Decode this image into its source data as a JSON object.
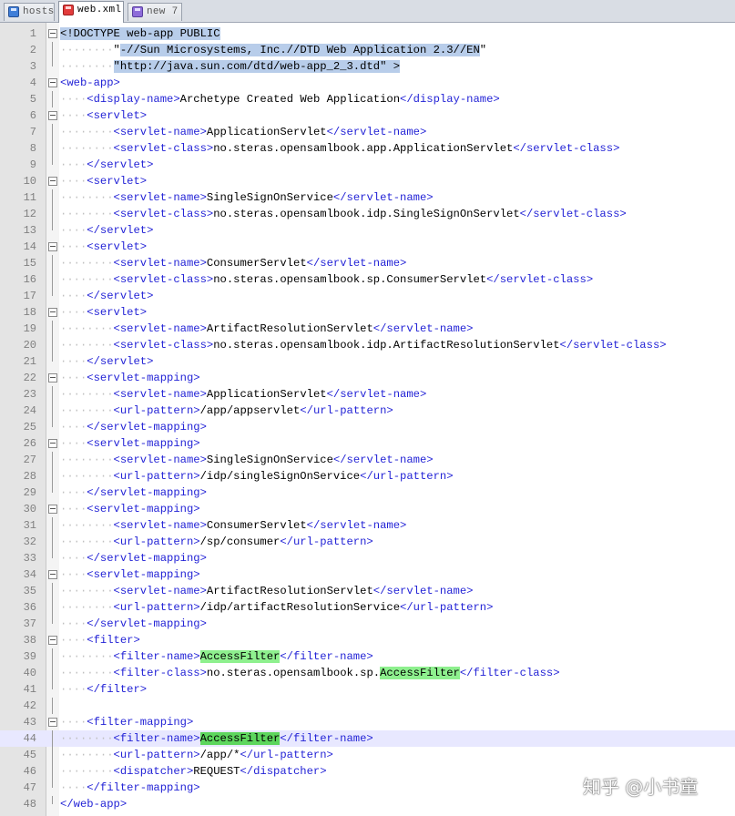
{
  "tabs": [
    {
      "label": "hosts",
      "icon": "save-icon",
      "active": false
    },
    {
      "label": "web.xml",
      "icon": "modified-save-icon",
      "active": true
    },
    {
      "label": "new  7",
      "icon": "new-file-icon",
      "active": false
    }
  ],
  "editor": {
    "current_line": 44,
    "lines": [
      {
        "n": "1",
        "fold": "open",
        "segs": [
          [
            "sel",
            "<"
          ],
          [
            "sel",
            "!DOCTYPE web-app PUBLIC"
          ]
        ]
      },
      {
        "n": "2",
        "fold": "line",
        "segs": [
          [
            "ws",
            "········"
          ],
          [
            "",
            "\""
          ],
          [
            "sel",
            "-//Sun Microsystems, Inc.//DTD Web Application 2.3//EN"
          ],
          [
            "",
            "\""
          ]
        ]
      },
      {
        "n": "3",
        "fold": "end",
        "segs": [
          [
            "ws",
            "········"
          ],
          [
            "sel",
            "\"http://java.sun.com/dtd/web-app_2_3.dtd\" >"
          ]
        ]
      },
      {
        "n": "4",
        "fold": "open",
        "segs": [
          [
            "t",
            "<web-app>"
          ]
        ]
      },
      {
        "n": "5",
        "fold": "line",
        "segs": [
          [
            "ws",
            "····"
          ],
          [
            "t",
            "<display-name>"
          ],
          [
            "",
            "Archetype Created Web Application"
          ],
          [
            "t",
            "</display-name>"
          ]
        ]
      },
      {
        "n": "6",
        "fold": "open",
        "segs": [
          [
            "ws",
            "····"
          ],
          [
            "t",
            "<servlet>"
          ]
        ]
      },
      {
        "n": "7",
        "fold": "line",
        "segs": [
          [
            "ws",
            "········"
          ],
          [
            "t",
            "<servlet-name>"
          ],
          [
            "",
            "ApplicationServlet"
          ],
          [
            "t",
            "</servlet-name>"
          ]
        ]
      },
      {
        "n": "8",
        "fold": "line",
        "segs": [
          [
            "ws",
            "········"
          ],
          [
            "t",
            "<servlet-class>"
          ],
          [
            "",
            "no.steras.opensamlbook.app.ApplicationServlet"
          ],
          [
            "t",
            "</servlet-class>"
          ]
        ]
      },
      {
        "n": "9",
        "fold": "end",
        "segs": [
          [
            "ws",
            "····"
          ],
          [
            "t",
            "</servlet>"
          ]
        ]
      },
      {
        "n": "10",
        "fold": "open",
        "segs": [
          [
            "ws",
            "····"
          ],
          [
            "t",
            "<servlet>"
          ]
        ]
      },
      {
        "n": "11",
        "fold": "line",
        "segs": [
          [
            "ws",
            "········"
          ],
          [
            "t",
            "<servlet-name>"
          ],
          [
            "",
            "SingleSignOnService"
          ],
          [
            "t",
            "</servlet-name>"
          ]
        ]
      },
      {
        "n": "12",
        "fold": "line",
        "segs": [
          [
            "ws",
            "········"
          ],
          [
            "t",
            "<servlet-class>"
          ],
          [
            "",
            "no.steras.opensamlbook.idp.SingleSignOnServlet"
          ],
          [
            "t",
            "</servlet-class>"
          ]
        ]
      },
      {
        "n": "13",
        "fold": "end",
        "segs": [
          [
            "ws",
            "····"
          ],
          [
            "t",
            "</servlet>"
          ]
        ]
      },
      {
        "n": "14",
        "fold": "open",
        "segs": [
          [
            "ws",
            "····"
          ],
          [
            "t",
            "<servlet>"
          ]
        ]
      },
      {
        "n": "15",
        "fold": "line",
        "segs": [
          [
            "ws",
            "········"
          ],
          [
            "t",
            "<servlet-name>"
          ],
          [
            "",
            "ConsumerServlet"
          ],
          [
            "t",
            "</servlet-name>"
          ]
        ]
      },
      {
        "n": "16",
        "fold": "line",
        "segs": [
          [
            "ws",
            "········"
          ],
          [
            "t",
            "<servlet-class>"
          ],
          [
            "",
            "no.steras.opensamlbook.sp.ConsumerServlet"
          ],
          [
            "t",
            "</servlet-class>"
          ]
        ]
      },
      {
        "n": "17",
        "fold": "end",
        "segs": [
          [
            "ws",
            "····"
          ],
          [
            "t",
            "</servlet>"
          ]
        ]
      },
      {
        "n": "18",
        "fold": "open",
        "segs": [
          [
            "ws",
            "····"
          ],
          [
            "t",
            "<servlet>"
          ]
        ]
      },
      {
        "n": "19",
        "fold": "line",
        "segs": [
          [
            "ws",
            "········"
          ],
          [
            "t",
            "<servlet-name>"
          ],
          [
            "",
            "ArtifactResolutionServlet"
          ],
          [
            "t",
            "</servlet-name>"
          ]
        ]
      },
      {
        "n": "20",
        "fold": "line",
        "segs": [
          [
            "ws",
            "········"
          ],
          [
            "t",
            "<servlet-class>"
          ],
          [
            "",
            "no.steras.opensamlbook.idp.ArtifactResolutionServlet"
          ],
          [
            "t",
            "</servlet-class>"
          ]
        ]
      },
      {
        "n": "21",
        "fold": "end",
        "segs": [
          [
            "ws",
            "····"
          ],
          [
            "t",
            "</servlet>"
          ]
        ]
      },
      {
        "n": "22",
        "fold": "open",
        "segs": [
          [
            "ws",
            "····"
          ],
          [
            "t",
            "<servlet-mapping>"
          ]
        ]
      },
      {
        "n": "23",
        "fold": "line",
        "segs": [
          [
            "ws",
            "········"
          ],
          [
            "t",
            "<servlet-name>"
          ],
          [
            "",
            "ApplicationServlet"
          ],
          [
            "t",
            "</servlet-name>"
          ]
        ]
      },
      {
        "n": "24",
        "fold": "line",
        "segs": [
          [
            "ws",
            "········"
          ],
          [
            "t",
            "<url-pattern>"
          ],
          [
            "",
            "/app/appservlet"
          ],
          [
            "t",
            "</url-pattern>"
          ]
        ]
      },
      {
        "n": "25",
        "fold": "end",
        "segs": [
          [
            "ws",
            "····"
          ],
          [
            "t",
            "</servlet-mapping>"
          ]
        ]
      },
      {
        "n": "26",
        "fold": "open",
        "segs": [
          [
            "ws",
            "····"
          ],
          [
            "t",
            "<servlet-mapping>"
          ]
        ]
      },
      {
        "n": "27",
        "fold": "line",
        "segs": [
          [
            "ws",
            "········"
          ],
          [
            "t",
            "<servlet-name>"
          ],
          [
            "",
            "SingleSignOnService"
          ],
          [
            "t",
            "</servlet-name>"
          ]
        ]
      },
      {
        "n": "28",
        "fold": "line",
        "segs": [
          [
            "ws",
            "········"
          ],
          [
            "t",
            "<url-pattern>"
          ],
          [
            "",
            "/idp/singleSignOnService"
          ],
          [
            "t",
            "</url-pattern>"
          ]
        ]
      },
      {
        "n": "29",
        "fold": "end",
        "segs": [
          [
            "ws",
            "····"
          ],
          [
            "t",
            "</servlet-mapping>"
          ]
        ]
      },
      {
        "n": "30",
        "fold": "open",
        "segs": [
          [
            "ws",
            "····"
          ],
          [
            "t",
            "<servlet-mapping>"
          ]
        ]
      },
      {
        "n": "31",
        "fold": "line",
        "segs": [
          [
            "ws",
            "········"
          ],
          [
            "t",
            "<servlet-name>"
          ],
          [
            "",
            "ConsumerServlet"
          ],
          [
            "t",
            "</servlet-name>"
          ]
        ]
      },
      {
        "n": "32",
        "fold": "line",
        "segs": [
          [
            "ws",
            "········"
          ],
          [
            "t",
            "<url-pattern>"
          ],
          [
            "",
            "/sp/consumer"
          ],
          [
            "t",
            "</url-pattern>"
          ]
        ]
      },
      {
        "n": "33",
        "fold": "end",
        "segs": [
          [
            "ws",
            "····"
          ],
          [
            "t",
            "</servlet-mapping>"
          ]
        ]
      },
      {
        "n": "34",
        "fold": "open",
        "segs": [
          [
            "ws",
            "····"
          ],
          [
            "t",
            "<servlet-mapping>"
          ]
        ]
      },
      {
        "n": "35",
        "fold": "line",
        "segs": [
          [
            "ws",
            "········"
          ],
          [
            "t",
            "<servlet-name>"
          ],
          [
            "",
            "ArtifactResolutionServlet"
          ],
          [
            "t",
            "</servlet-name>"
          ]
        ]
      },
      {
        "n": "36",
        "fold": "line",
        "segs": [
          [
            "ws",
            "········"
          ],
          [
            "t",
            "<url-pattern>"
          ],
          [
            "",
            "/idp/artifactResolutionService"
          ],
          [
            "t",
            "</url-pattern>"
          ]
        ]
      },
      {
        "n": "37",
        "fold": "end",
        "segs": [
          [
            "ws",
            "····"
          ],
          [
            "t",
            "</servlet-mapping>"
          ]
        ]
      },
      {
        "n": "38",
        "fold": "open",
        "segs": [
          [
            "ws",
            "····"
          ],
          [
            "t",
            "<filter>"
          ]
        ]
      },
      {
        "n": "39",
        "fold": "line",
        "segs": [
          [
            "ws",
            "········"
          ],
          [
            "t",
            "<filter-name>"
          ],
          [
            "hl",
            "AccessFilter"
          ],
          [
            "t",
            "</filter-name>"
          ]
        ]
      },
      {
        "n": "40",
        "fold": "line",
        "segs": [
          [
            "ws",
            "········"
          ],
          [
            "t",
            "<filter-class>"
          ],
          [
            "",
            "no.steras.opensamlbook.sp."
          ],
          [
            "hl",
            "AccessFilter"
          ],
          [
            "t",
            "</filter-class>"
          ]
        ]
      },
      {
        "n": "41",
        "fold": "end",
        "segs": [
          [
            "ws",
            "····"
          ],
          [
            "t",
            "</filter>"
          ]
        ]
      },
      {
        "n": "42",
        "fold": "line",
        "segs": []
      },
      {
        "n": "43",
        "fold": "open",
        "segs": [
          [
            "ws",
            "····"
          ],
          [
            "t",
            "<filter-mapping>"
          ]
        ]
      },
      {
        "n": "44",
        "fold": "line",
        "segs": [
          [
            "ws",
            "········"
          ],
          [
            "t",
            "<filter-name>"
          ],
          [
            "hl2",
            "AccessFilter"
          ],
          [
            "t",
            "</filter-name>"
          ]
        ]
      },
      {
        "n": "45",
        "fold": "line",
        "segs": [
          [
            "ws",
            "········"
          ],
          [
            "t",
            "<url-pattern>"
          ],
          [
            "",
            "/app/*"
          ],
          [
            "t",
            "</url-pattern>"
          ]
        ]
      },
      {
        "n": "46",
        "fold": "line",
        "segs": [
          [
            "ws",
            "········"
          ],
          [
            "t",
            "<dispatcher>"
          ],
          [
            "",
            "REQUEST"
          ],
          [
            "t",
            "</dispatcher>"
          ]
        ]
      },
      {
        "n": "47",
        "fold": "end",
        "segs": [
          [
            "ws",
            "····"
          ],
          [
            "t",
            "</filter-mapping>"
          ]
        ]
      },
      {
        "n": "48",
        "fold": "end",
        "segs": [
          [
            "t",
            "</web-app>"
          ]
        ]
      }
    ]
  },
  "watermark": "知乎 @小书童"
}
